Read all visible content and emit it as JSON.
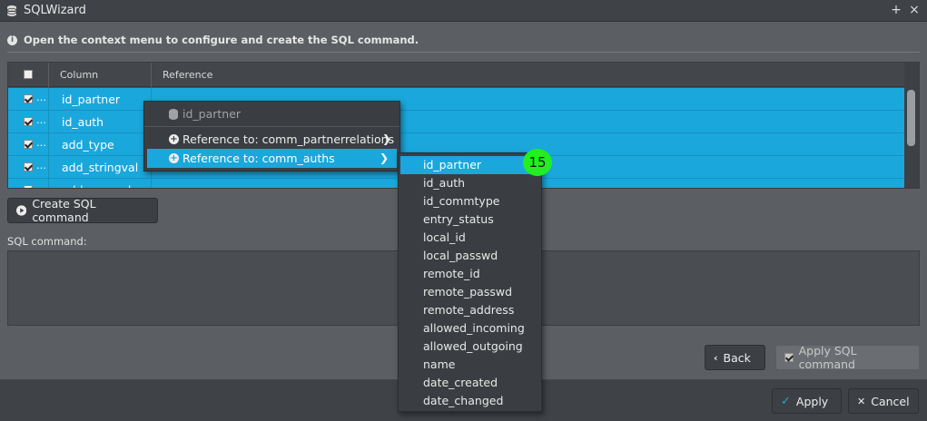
{
  "window": {
    "title": "SQLWizard",
    "maximize_label": "+",
    "close_label": "×"
  },
  "info": {
    "text": "Open the context menu to configure and create the SQL command."
  },
  "grid": {
    "columns": {
      "column": "Column",
      "reference": "Reference"
    },
    "rows": [
      {
        "column": "id_partner",
        "dots": "…"
      },
      {
        "column": "id_auth",
        "dots": "…"
      },
      {
        "column": "add_type",
        "dots": "…"
      },
      {
        "column": "add_stringval",
        "dots": "…"
      },
      {
        "column": "add_numval",
        "dots": "…"
      }
    ]
  },
  "buttons": {
    "create_sql": "Create SQL command",
    "back": "Back",
    "apply_sql": "Apply SQL command",
    "apply": "Apply",
    "cancel": "Cancel"
  },
  "sql": {
    "label": "SQL command:",
    "value": ""
  },
  "context_menu": {
    "header": "id_partner",
    "items": [
      {
        "label": "Reference to: comm_partnerrelations"
      },
      {
        "label": "Reference to: comm_auths"
      }
    ]
  },
  "submenu": {
    "items": [
      "id_partner",
      "id_auth",
      "id_commtype",
      "entry_status",
      "local_id",
      "local_passwd",
      "remote_id",
      "remote_passwd",
      "remote_address",
      "allowed_incoming",
      "allowed_outgoing",
      "name",
      "date_created",
      "date_changed"
    ]
  },
  "badge": {
    "label": "15",
    "color": "#22ee22"
  },
  "colors": {
    "accent": "#1aa7dc",
    "background": "#5b5f63",
    "titlebar": "#3f4347"
  }
}
